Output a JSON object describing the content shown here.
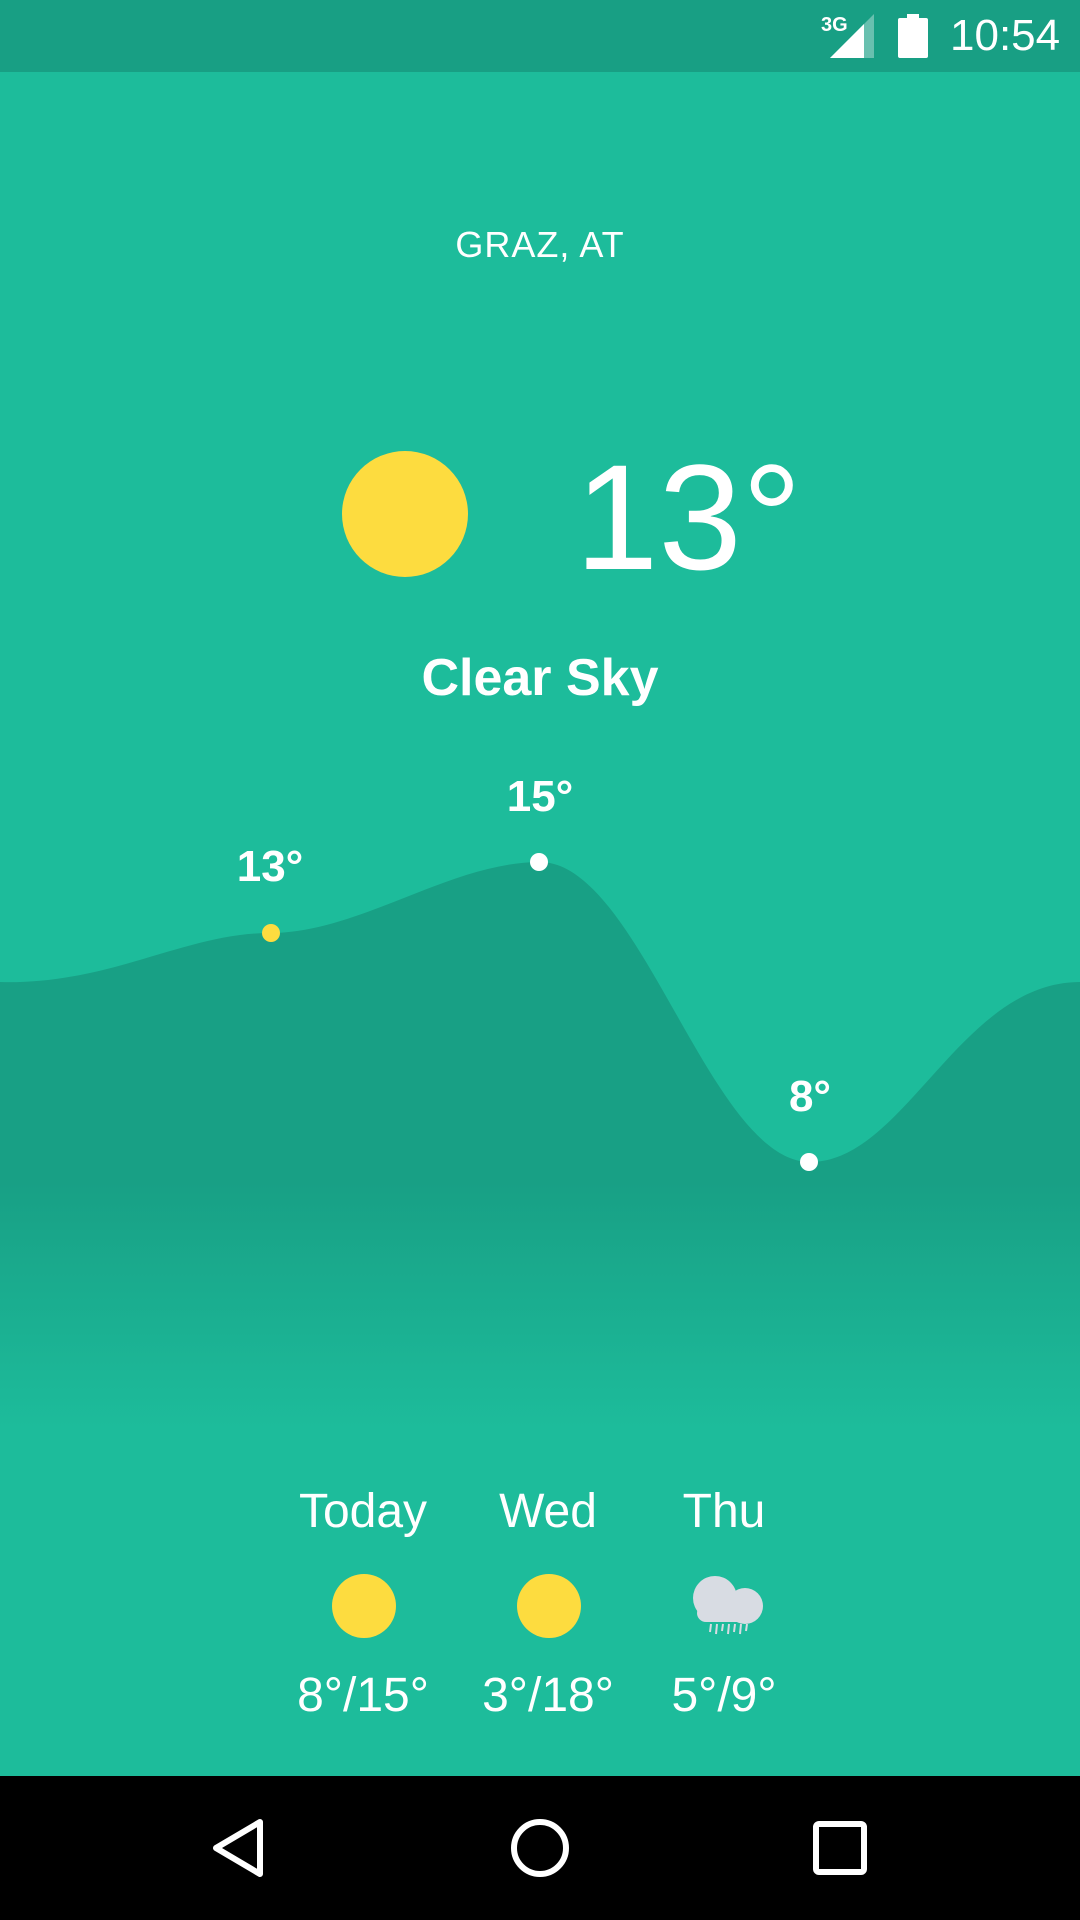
{
  "status_bar": {
    "network_type": "3G",
    "time": "10:54",
    "icons": [
      "signal-icon",
      "battery-icon"
    ]
  },
  "weather": {
    "location": "GRAZ, AT",
    "current_temp": "13°",
    "condition": "Clear Sky",
    "icon": "sun-icon"
  },
  "graph": {
    "points": [
      {
        "label": "13°",
        "value": 13,
        "dot_color": "#FDDC3F"
      },
      {
        "label": "15°",
        "value": 15,
        "dot_color": "#FFFFFF"
      },
      {
        "label": "8°",
        "value": 8,
        "dot_color": "#FFFFFF"
      }
    ]
  },
  "forecast": [
    {
      "day": "Today",
      "icon": "sun-icon",
      "temps": "8°/15°"
    },
    {
      "day": "Wed",
      "icon": "sun-icon",
      "temps": "3°/18°"
    },
    {
      "day": "Thu",
      "icon": "rain-cloud-icon",
      "temps": "5°/9°"
    }
  ],
  "navigation": {
    "items": [
      "back-icon",
      "home-icon",
      "recents-icon"
    ]
  },
  "colors": {
    "background": "#1DBC9B",
    "status_bar": "#189F84",
    "wave": "#18A085",
    "sun": "#FDDC3F",
    "cloud": "#D8DCE3",
    "nav_bar": "#000000"
  }
}
